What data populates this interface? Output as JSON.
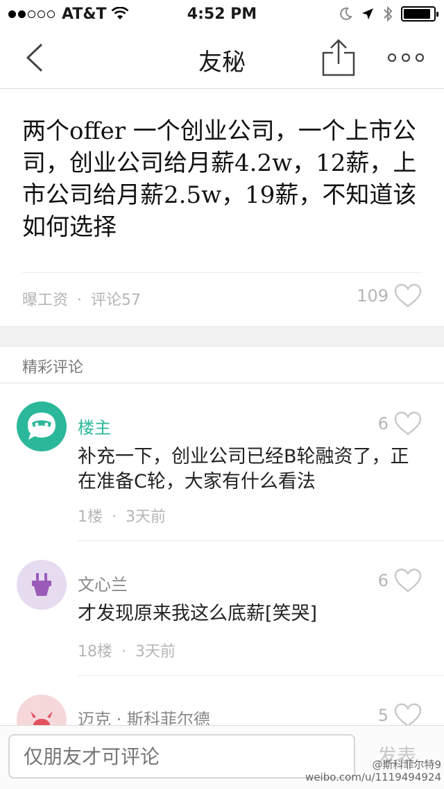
{
  "status_bar": {
    "carrier": "AT&T",
    "time": "4:52 PM",
    "signal_filled": 2,
    "signal_total": 5,
    "battery_level": 0.9
  },
  "nav": {
    "title": "友秘",
    "back_icon": "chevron-left-icon",
    "share_icon": "share-icon",
    "more_icon": "more-icon"
  },
  "post": {
    "title": "两个offer 一个创业公司，一个上市公司，创业公司给月薪4.2w，12薪，上市公司给月薪2.5w，19薪，不知道该如何选择",
    "category": "曝工资",
    "separator": "·",
    "comment_count": "评论57",
    "likes": "109"
  },
  "section": {
    "title": "精彩评论"
  },
  "comments": [
    {
      "name": "楼主",
      "likes": "6",
      "text": "补充一下，创业公司已经B轮融资了，正在准备C轮，大家有什么看法",
      "floor": "1楼",
      "separator": "·",
      "time": "3天前",
      "avatar_color": "#2bb89a",
      "avatar_icon": "masked-chat-bubble-icon"
    },
    {
      "name": "文心兰",
      "likes": "6",
      "text": "才发现原来我这么底薪[笑哭]",
      "floor": "18楼",
      "separator": "·",
      "time": "3天前",
      "avatar_color": "#e6dbef",
      "avatar_icon": "plug-icon"
    },
    {
      "name": "迈克 · 斯科菲尔德",
      "likes": "5",
      "avatar_color": "#f6d8db",
      "avatar_icon": "crab-icon"
    }
  ],
  "bottom_bar": {
    "input_placeholder": "仅朋友才可评论",
    "send_label": "发表"
  },
  "watermark": {
    "line1": "@斯科菲尔特9",
    "line2": "weibo.com/u/1119494924"
  },
  "colors": {
    "accent": "#2bb89a",
    "secondary_text": "#b5b5b5",
    "divider": "#e6e6e6"
  }
}
